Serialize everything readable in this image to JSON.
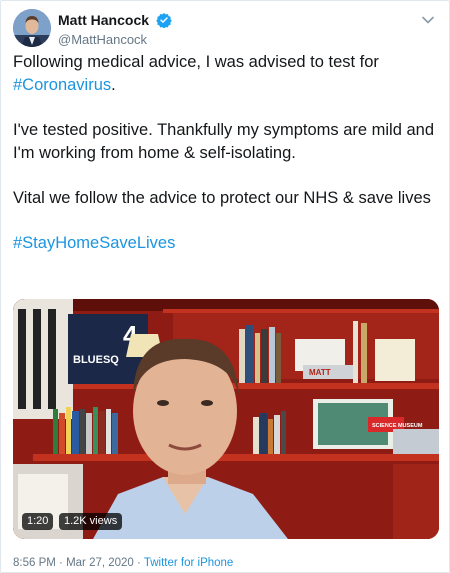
{
  "user": {
    "display_name": "Matt Hancock",
    "handle": "@MattHancock",
    "verified": true
  },
  "tweet": {
    "line1": "Following medical advice, I was advised to test for",
    "hashtag1": "#Coronavirus",
    "line1_end": ".",
    "para2": "I've tested positive. Thankfully my symptoms are mild and I'm working from home & self-isolating.",
    "para3": "Vital we follow the advice to protect our NHS & save lives",
    "hashtag2": "#StayHomeSaveLives"
  },
  "media": {
    "duration": "1:20",
    "views": "1.2K views",
    "shelf_labels": {
      "bluesq": "BLUESQ",
      "number": "4",
      "matt": "MATT",
      "science_museum": "SCIENCE MUSEUM"
    }
  },
  "footer": {
    "time": "8:56 PM",
    "separator1": " · ",
    "date": "Mar 27, 2020",
    "separator2": " · ",
    "source": "Twitter for iPhone"
  },
  "colors": {
    "link": "#1b95e0",
    "verified": "#1da1f2",
    "secondary_text": "#657786",
    "wall": "#8a1a12"
  },
  "icons": {
    "verified": "verified-badge-icon",
    "menu": "chevron-down-icon"
  }
}
